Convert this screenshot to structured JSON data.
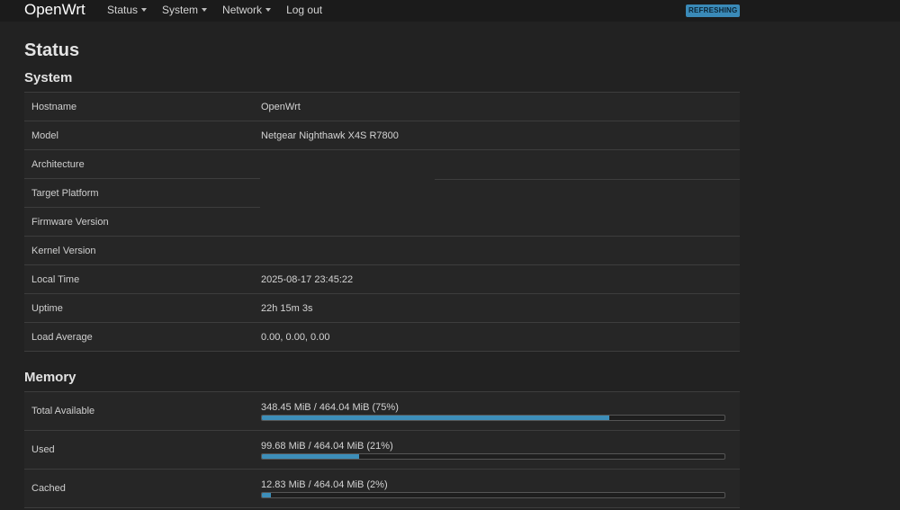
{
  "nav": {
    "brand": "OpenWrt",
    "menu": [
      "Status",
      "System",
      "Network",
      "Log out"
    ],
    "badge": "REFRESHING"
  },
  "page_title": "Status",
  "system": {
    "title": "System",
    "rows": [
      {
        "key": "Hostname",
        "value": "OpenWrt"
      },
      {
        "key": "Model",
        "value": "Netgear Nighthawk X4S R7800"
      },
      {
        "key": "Architecture",
        "value": ""
      },
      {
        "key": "Target Platform",
        "value": ""
      },
      {
        "key": "Firmware Version",
        "value": ""
      },
      {
        "key": "Kernel Version",
        "value": ""
      },
      {
        "key": "Local Time",
        "value": "2025-08-17 23:45:22"
      },
      {
        "key": "Uptime",
        "value": "22h 15m 3s"
      },
      {
        "key": "Load Average",
        "value": "0.00, 0.00, 0.00"
      }
    ]
  },
  "memory": {
    "title": "Memory",
    "rows": [
      {
        "key": "Total Available",
        "label": "348.45 MiB / 464.04 MiB (75%)",
        "fraction": 0.75
      },
      {
        "key": "Used",
        "label": "99.68 MiB / 464.04 MiB (21%)",
        "fraction": 0.21
      },
      {
        "key": "Cached",
        "label": "12.83 MiB / 464.04 MiB (2%)",
        "fraction": 0.02
      }
    ]
  },
  "colors": {
    "background": "#222222",
    "bar_fill": "#3d8eb9",
    "badge": "#3a8ab8"
  }
}
